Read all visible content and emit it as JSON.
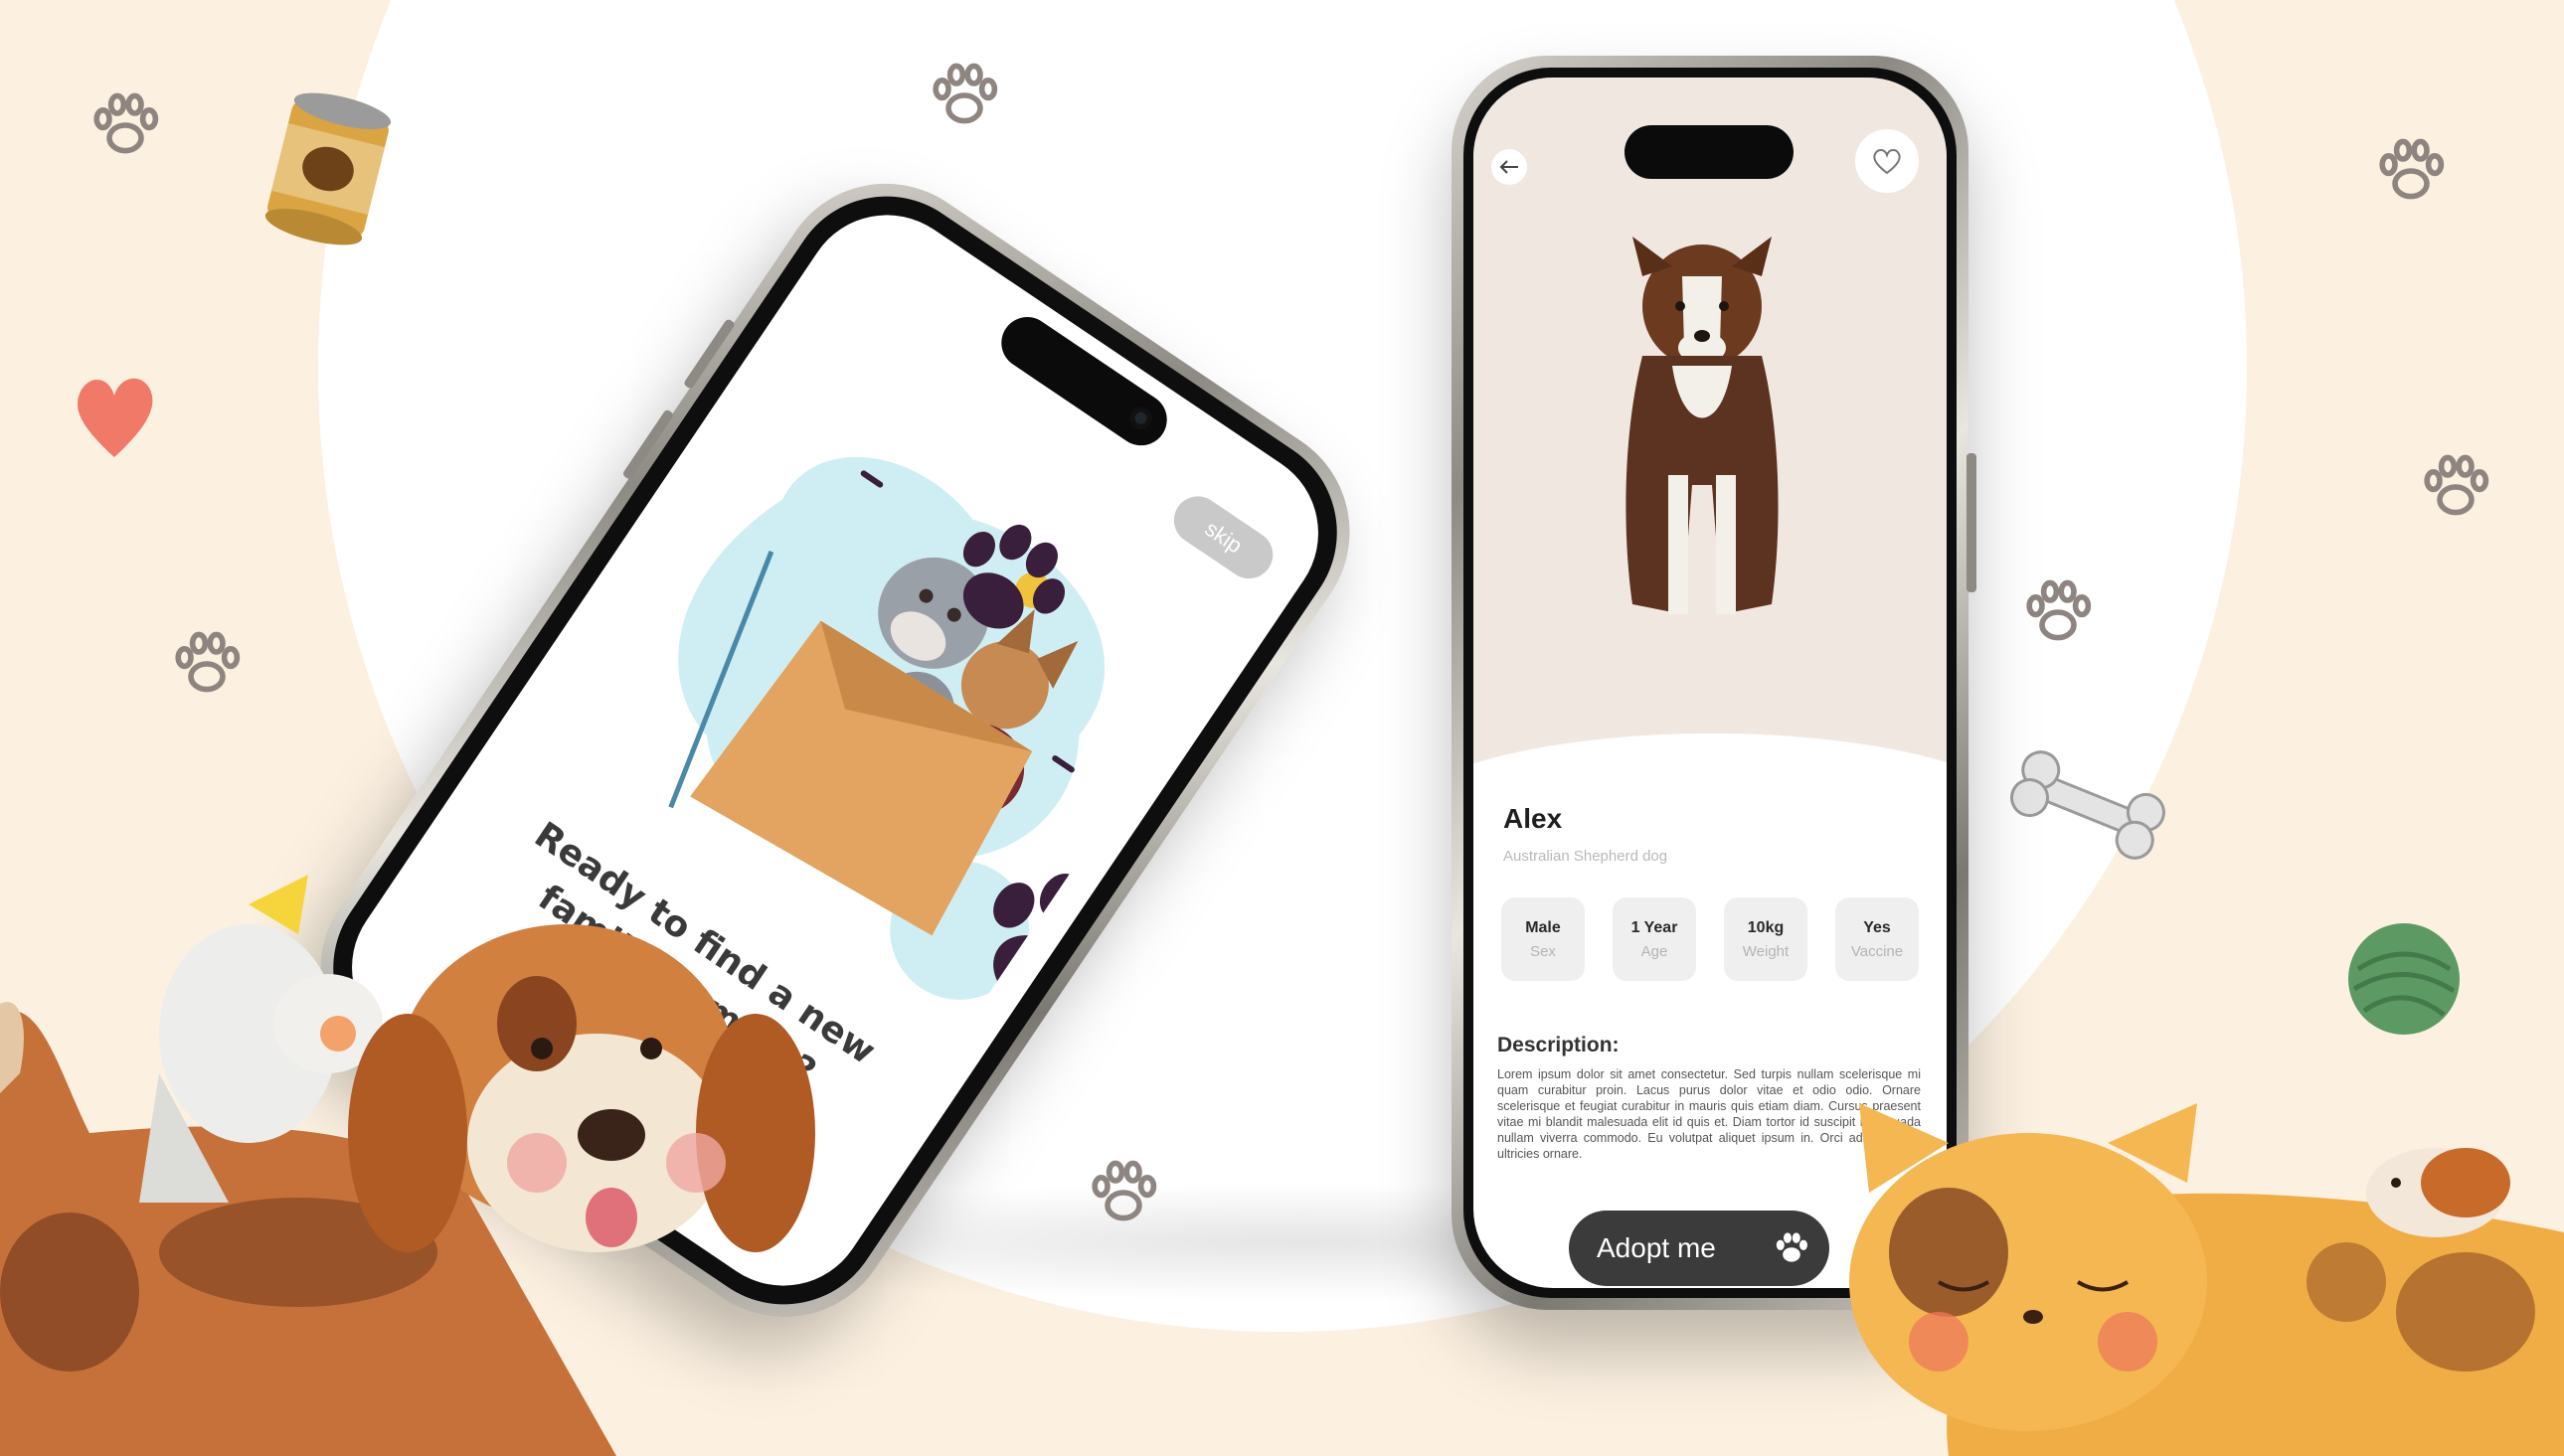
{
  "onboarding_screen": {
    "title": "Ready to find a new family member?",
    "skip_label": "skip"
  },
  "details_screen": {
    "pet_name": "Alex",
    "breed": "Australian Shepherd dog",
    "stats": [
      {
        "value": "Male",
        "label": "Sex"
      },
      {
        "value": "1 Year",
        "label": "Age"
      },
      {
        "value": "10kg",
        "label": "Weight"
      },
      {
        "value": "Yes",
        "label": "Vaccine"
      }
    ],
    "description_title": "Description:",
    "description_text": "Lorem ipsum dolor sit amet consectetur. Sed turpis nullam scelerisque mi quam curabitur proin. Lacus purus dolor vitae et odio odio. Ornare scelerisque et feugiat curabitur in mauris quis etiam diam. Cursus praesent vitae mi blandit malesuada elit id quis et. Diam tortor id suscipit malesuada nullam viverra commodo. Eu volutpat aliquet ipsum in. Orci adipiscing et ultricies ornare.",
    "adopt_label": "Adopt me"
  },
  "icons": {
    "back": "back-arrow-icon",
    "favorite": "heart-outline-icon",
    "adopt": "paw-icon"
  },
  "colors": {
    "background": "#fcf1e1",
    "hero_bg": "#f1e7e1",
    "button_dark": "#3b3b3b",
    "accent_blue": "#cfeef3",
    "paw_purple": "#3a1f3d"
  }
}
